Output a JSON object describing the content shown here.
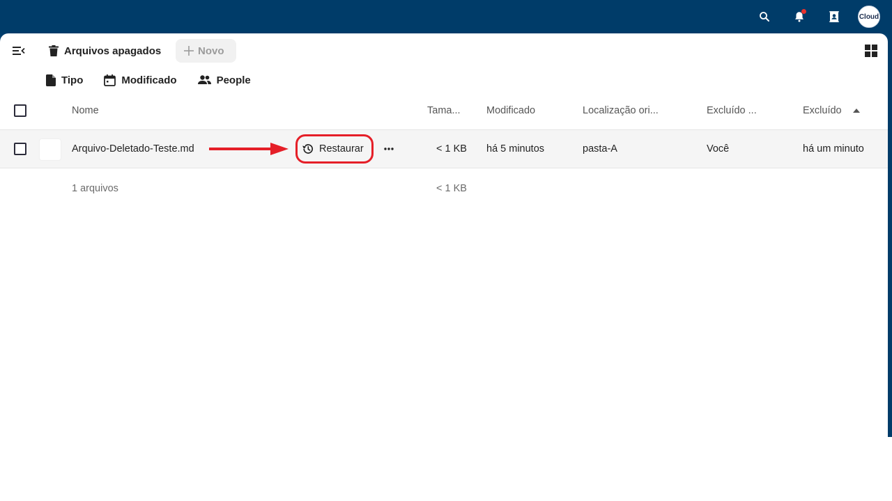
{
  "header": {
    "avatar_text": "Cloud",
    "icons": [
      "search-icon",
      "notifications-icon",
      "contacts-icon"
    ]
  },
  "toolbar": {
    "breadcrumb": "Arquivos apagados",
    "new_label": "Novo"
  },
  "filters": [
    {
      "label": "Tipo",
      "icon": "file-icon"
    },
    {
      "label": "Modificado",
      "icon": "calendar-icon"
    },
    {
      "label": "People",
      "icon": "people-icon"
    }
  ],
  "columns": {
    "name": "Nome",
    "size": "Tama...",
    "modified": "Modificado",
    "original_location": "Localização ori...",
    "deleted_by": "Excluído ...",
    "deleted": "Excluído"
  },
  "files": [
    {
      "name": "Arquivo-Deletado-Teste.md",
      "action": "Restaurar",
      "size": "< 1 KB",
      "modified": "há 5 minutos",
      "original_location": "pasta-A",
      "deleted_by": "Você",
      "deleted": "há um minuto"
    }
  ],
  "summary": {
    "count": "1 arquivos",
    "size": "< 1 KB"
  },
  "colors": {
    "topbar": "#003c69",
    "annotation": "#e51f28"
  }
}
